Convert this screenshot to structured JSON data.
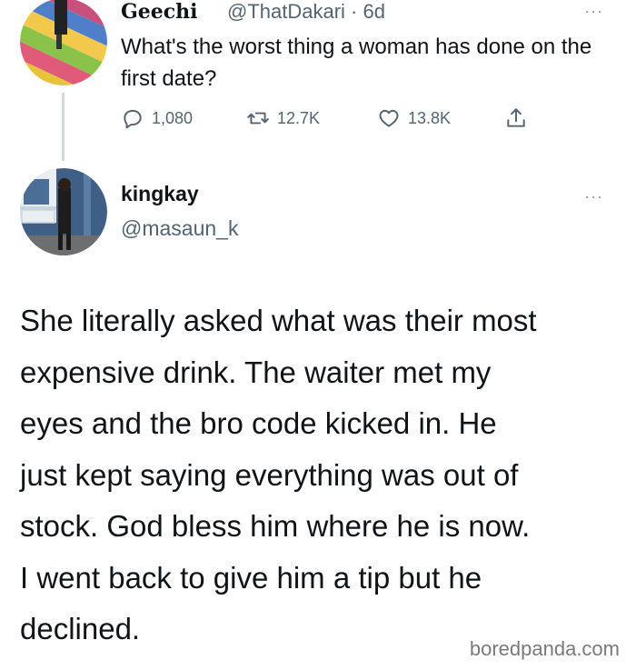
{
  "original_tweet": {
    "author_name": "Geechi",
    "author_handle_time": "@ThatDakari · 6d",
    "text": "What's the worst thing a woman has done on the first date?",
    "more_glyph": "···",
    "stats": {
      "replies": "1,080",
      "retweets": "12.7K",
      "likes": "13.8K"
    },
    "icons": {
      "reply": "reply-icon",
      "retweet": "retweet-icon",
      "like": "heart-icon",
      "share": "share-icon"
    }
  },
  "reply_tweet": {
    "author_name": "kingkay",
    "author_handle": "@masaun_k",
    "more_glyph": "···",
    "lines": [
      "She literally asked what was their most",
      "expensive drink. The waiter met my",
      "eyes and the bro code kicked in. He",
      "just kept saying everything was out of",
      "stock. God bless him where he is now.",
      "I went back to give him a tip but he",
      "declined."
    ]
  },
  "watermark": "boredpanda.com",
  "colors": {
    "text": "#0f1419",
    "muted": "#536471",
    "thread_line": "#cfd9de"
  }
}
